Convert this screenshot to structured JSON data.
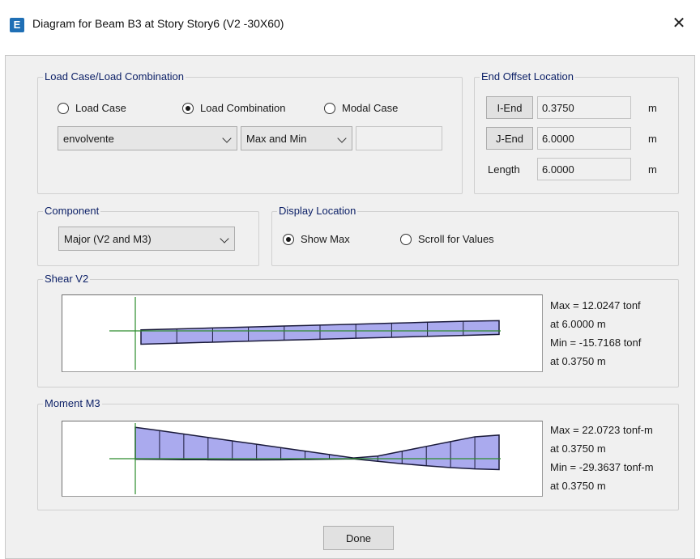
{
  "window": {
    "icon_letter": "E",
    "title": "Diagram for Beam B3 at Story Story6 (V2 -30X60)",
    "close_glyph": "✕"
  },
  "load_case": {
    "group_title": "Load Case/Load Combination",
    "options": [
      "Load Case",
      "Load Combination",
      "Modal Case"
    ],
    "selected": "Load Combination",
    "combo_value": "envolvente",
    "type_value": "Max and Min",
    "extra_value": ""
  },
  "end_offset": {
    "group_title": "End Offset Location",
    "i_end_label": "I-End",
    "i_end_value": "0.3750",
    "j_end_label": "J-End",
    "j_end_value": "6.0000",
    "length_label": "Length",
    "length_value": "6.0000",
    "unit": "m"
  },
  "component": {
    "group_title": "Component",
    "value": "Major (V2 and M3)"
  },
  "display_location": {
    "group_title": "Display Location",
    "options": [
      "Show Max",
      "Scroll for Values"
    ],
    "selected": "Show Max"
  },
  "shear": {
    "group_title": "Shear V2",
    "max_text": "Max = 12.0247 tonf",
    "max_loc": "at 6.0000 m",
    "min_text": "Min = -15.7168 tonf",
    "min_loc": "at 0.3750 m",
    "diagram": {
      "x_start": 0.375,
      "x_end": 6.0,
      "max_values": [
        1.2,
        2.3,
        3.4,
        4.5,
        5.7,
        6.8,
        7.9,
        9.0,
        10.2,
        11.3,
        12.0247
      ],
      "min_values": [
        -15.7168,
        -14.5,
        -13.3,
        -12.2,
        -11.0,
        -9.9,
        -8.7,
        -7.6,
        -6.4,
        -5.3,
        -4.2
      ]
    }
  },
  "moment": {
    "group_title": "Moment M3",
    "max_text": "Max = 22.0723 tonf-m",
    "max_loc": "at 0.3750 m",
    "min_text": "Min = -29.3637 tonf-m",
    "min_loc": "at 0.3750 m",
    "diagram": {
      "x_start": 0.375,
      "x_end": 6.0,
      "upper_values": [
        29.3637,
        26.3,
        23.1,
        19.9,
        16.7,
        13.5,
        10.3,
        7.1,
        3.9,
        0.7,
        2.5,
        7.0,
        11.5,
        16.0,
        20.5,
        22.0723
      ],
      "lower_values": [
        -0.5,
        -0.7,
        -0.9,
        -1.0,
        -1.1,
        -1.1,
        -1.0,
        -0.8,
        -0.5,
        -0.2,
        -2.5,
        -4.7,
        -6.6,
        -8.3,
        -9.6,
        -10.2
      ]
    },
    "fill_color": "#aaaaee",
    "axis_color": "#2c8c2c"
  },
  "footer": {
    "done_label": "Done"
  }
}
